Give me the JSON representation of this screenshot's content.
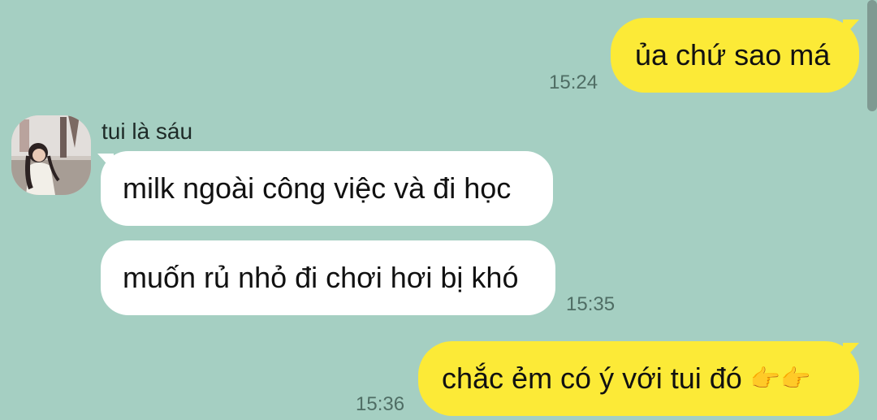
{
  "contact": {
    "name": "tui là sáu"
  },
  "messages": [
    {
      "direction": "outgoing",
      "text": "ủa chứ sao má",
      "time": "15:24"
    },
    {
      "direction": "incoming",
      "text": "milk ngoài công việc và đi học"
    },
    {
      "direction": "incoming",
      "text": "muốn rủ nhỏ đi chơi hơi bị khó",
      "time": "15:35"
    },
    {
      "direction": "outgoing",
      "text": "chắc ẻm có ý với tui đó",
      "emoji": "👉👉",
      "time": "15:36"
    }
  ],
  "colors": {
    "background": "#a5cfc2",
    "outgoing_bubble": "#fcea37",
    "incoming_bubble": "#ffffff",
    "timestamp": "#4f6d64"
  },
  "icons": {
    "avatar": "contact-photo",
    "emoji": "pointing-right-hands"
  }
}
